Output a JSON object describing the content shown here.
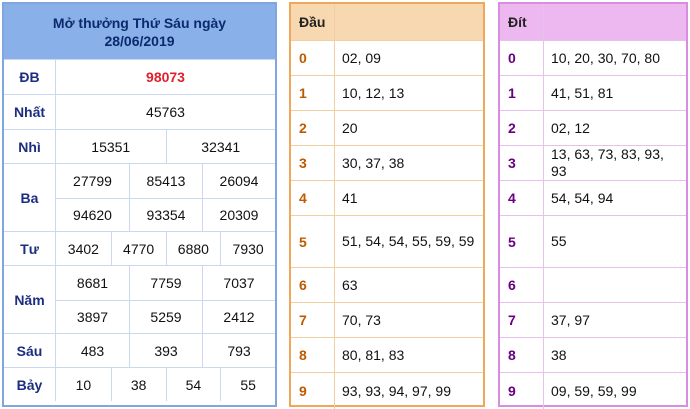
{
  "result": {
    "title_line1": "Mở thưởng Thứ Sáu ngày",
    "title_line2": "28/06/2019",
    "prizes": [
      {
        "label": "ĐB",
        "rows": [
          [
            "98073"
          ]
        ]
      },
      {
        "label": "Nhất",
        "rows": [
          [
            "45763"
          ]
        ]
      },
      {
        "label": "Nhì",
        "rows": [
          [
            "15351",
            "32341"
          ]
        ]
      },
      {
        "label": "Ba",
        "rows": [
          [
            "27799",
            "85413",
            "26094"
          ],
          [
            "94620",
            "93354",
            "20309"
          ]
        ]
      },
      {
        "label": "Tư",
        "rows": [
          [
            "3402",
            "4770",
            "6880",
            "7930"
          ]
        ]
      },
      {
        "label": "Năm",
        "rows": [
          [
            "8681",
            "7759",
            "7037"
          ],
          [
            "3897",
            "5259",
            "2412"
          ]
        ]
      },
      {
        "label": "Sáu",
        "rows": [
          [
            "483",
            "393",
            "793"
          ]
        ]
      },
      {
        "label": "Bảy",
        "rows": [
          [
            "10",
            "38",
            "54",
            "55"
          ]
        ]
      }
    ]
  },
  "dau": {
    "header": "Đầu",
    "rows": [
      {
        "key": "0",
        "value": "02, 09"
      },
      {
        "key": "1",
        "value": "10, 12, 13"
      },
      {
        "key": "2",
        "value": "20"
      },
      {
        "key": "3",
        "value": "30, 37, 38"
      },
      {
        "key": "4",
        "value": "41"
      },
      {
        "key": "5",
        "value": "51, 54, 54, 55, 59, 59"
      },
      {
        "key": "6",
        "value": "63"
      },
      {
        "key": "7",
        "value": "70, 73"
      },
      {
        "key": "8",
        "value": "80, 81, 83"
      },
      {
        "key": "9",
        "value": "93, 93, 94, 97, 99"
      }
    ]
  },
  "dit": {
    "header": "Đít",
    "rows": [
      {
        "key": "0",
        "value": "10, 20, 30, 70, 80"
      },
      {
        "key": "1",
        "value": "41, 51, 81"
      },
      {
        "key": "2",
        "value": "02, 12"
      },
      {
        "key": "3",
        "value": "13, 63, 73, 83, 93, 93"
      },
      {
        "key": "4",
        "value": "54, 54, 94"
      },
      {
        "key": "5",
        "value": "55"
      },
      {
        "key": "6",
        "value": ""
      },
      {
        "key": "7",
        "value": "37, 97"
      },
      {
        "key": "8",
        "value": "38"
      },
      {
        "key": "9",
        "value": "09, 59, 59, 99"
      }
    ]
  },
  "colors": {
    "result_border": "#7fa7de",
    "result_header": "#8ab0ea",
    "special_prize": "#e0202c",
    "dau_border": "#f0a75a",
    "dau_header": "#f7d8b0",
    "dit_border": "#d98de0",
    "dit_header": "#edb8f0"
  }
}
